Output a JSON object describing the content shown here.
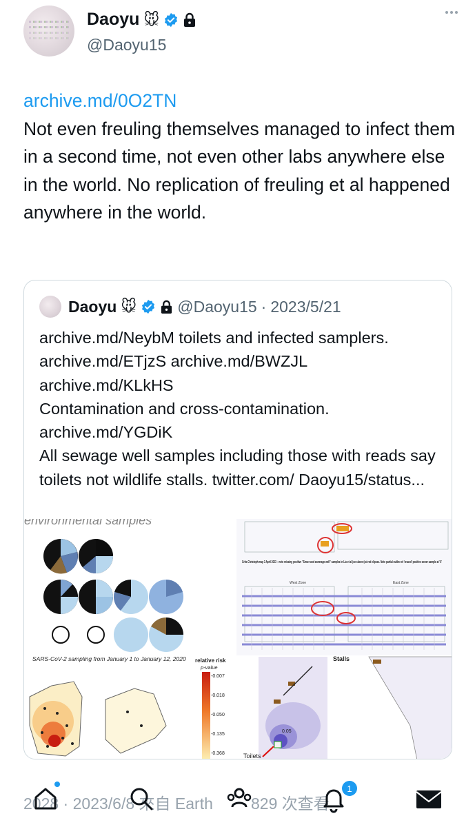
{
  "author": {
    "name": "Daoyu",
    "emoji": "🐭",
    "handle": "@Daoyu15"
  },
  "tweet": {
    "link": "archive.md/0O2TN",
    "text": "Not even freuling themselves managed to infect them in a second time, not even other labs anywhere else in the world. No replication of freuling et al happened anywhere in the world."
  },
  "quoted": {
    "name": "Daoyu",
    "emoji": "🐭",
    "handle": "@Daoyu15",
    "separator": "·",
    "date": "2023/5/21",
    "text": "archive.md/NeybM toilets and infected samplers. archive.md/ETjzS archive.md/BWZJL archive.md/KLkHS\nContamination and cross-contamination. archive.md/YGDiK\nAll sewage well samples including those with reads say toilets not wildlife stalls. twitter.com/ Daoyu15/status...",
    "media": {
      "header_text": "environmental samples",
      "map_caption": "Crits-Christoph map 3 April 2023 – note missing positive \"Sewer and sewerage well\" samples in Liu et al (see above) at red elipses. Note partial outline of 'erased' positive sewer sample at 'X'",
      "map_zone_west": "West Zone",
      "map_zone_east": "East Zone",
      "heat_title": "SARS-CoV-2 sampling from January 1 to January 12, 2020",
      "legend_title": "relative risk",
      "legend_subtitle": "p-value",
      "legend_ticks": [
        "-0.007",
        "-0.018",
        "-0.050",
        "-0.135",
        "-0.368"
      ],
      "stalls_label": "Stalls",
      "contour_label": "0.05",
      "toilets_label": "Toilets"
    }
  },
  "footer": {
    "meta": "2028 · 2023/6/8 來自 Earth",
    "views": "829 次查看",
    "notification_count": "1"
  },
  "colors": {
    "accent": "#1d9bf0",
    "text": "#0f1419",
    "muted": "#536471"
  }
}
